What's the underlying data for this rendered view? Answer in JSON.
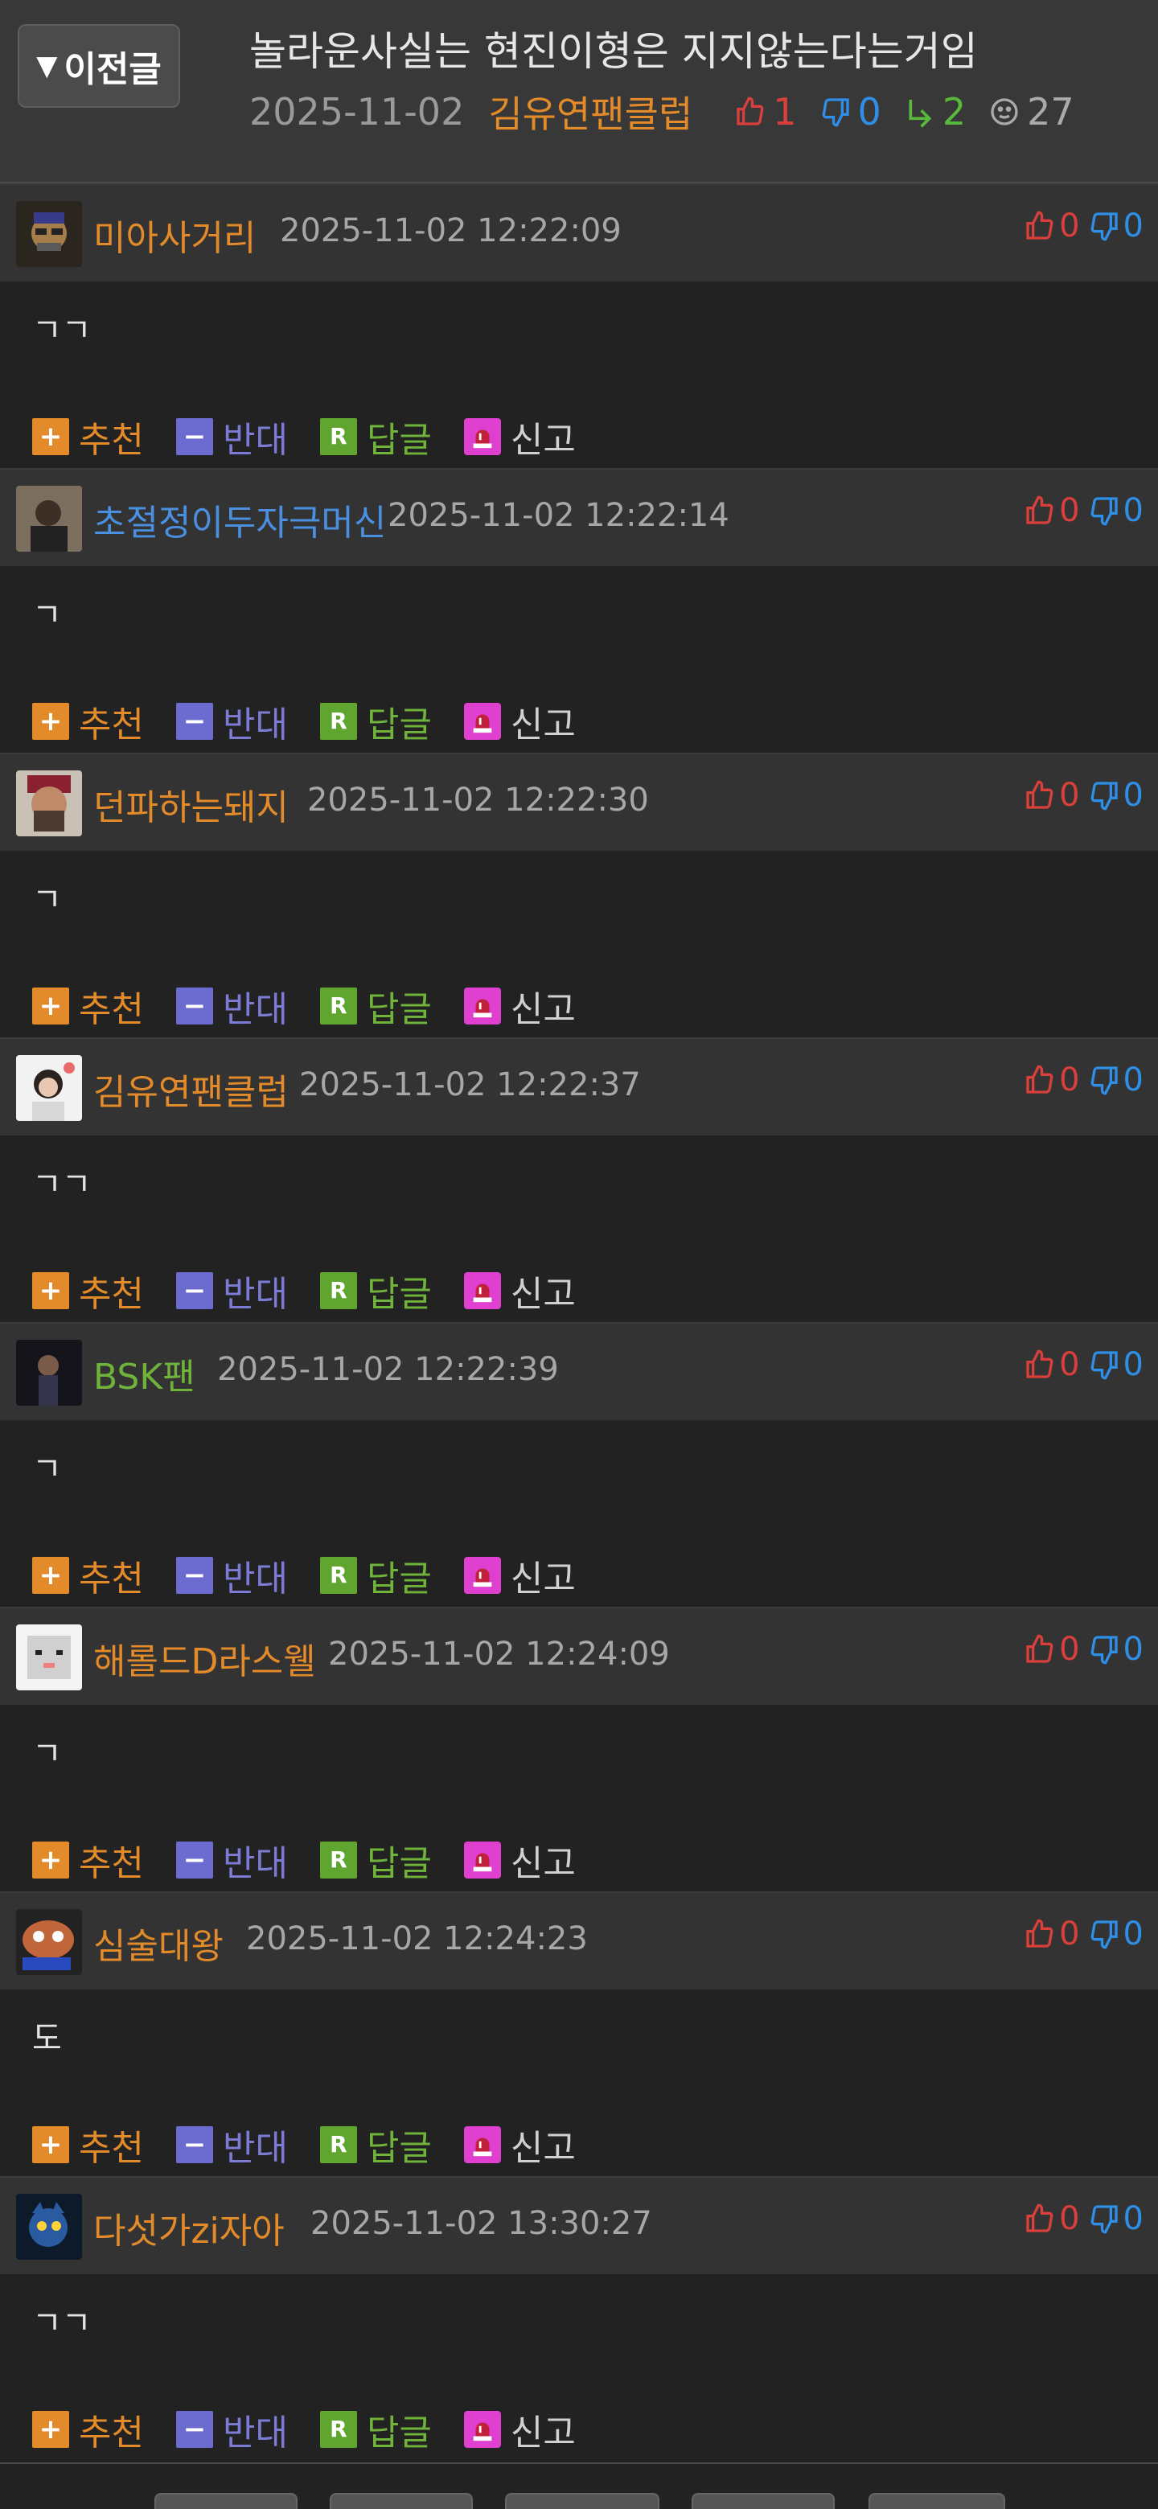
{
  "header": {
    "prev_label": "이전글",
    "title": "놀라운사실는 현진이형은 지지않는다는거임",
    "date": "2025-11-02",
    "author": "김유연팬클럽",
    "likes": "1",
    "dislikes": "0",
    "replies": "2",
    "views": "27"
  },
  "actions": {
    "recommend": "추천",
    "oppose": "반대",
    "reply": "답글",
    "report": "신고"
  },
  "colors": {
    "background": "#222222",
    "header": "#383838",
    "orange": "#e38a2a",
    "blue": "#4a8fe0",
    "green": "#6fb33b",
    "red": "#d9403c"
  },
  "comments": [
    {
      "nick": "미아사거리",
      "nick_color": "orange",
      "time": "2025-11-02 12:22:09",
      "up": "0",
      "down": "0",
      "text": "ㄱㄱ",
      "avatar": "avatar-1"
    },
    {
      "nick": "초절정이두자극머신",
      "nick_color": "blue",
      "time": "2025-11-02 12:22:14",
      "up": "0",
      "down": "0",
      "text": "ㄱ",
      "avatar": "avatar-2"
    },
    {
      "nick": "던파하는돼지",
      "nick_color": "orange",
      "time": "2025-11-02 12:22:30",
      "up": "0",
      "down": "0",
      "text": "ㄱ",
      "avatar": "avatar-3"
    },
    {
      "nick": "김유연팬클럽",
      "nick_color": "orange",
      "time": "2025-11-02 12:22:37",
      "up": "0",
      "down": "0",
      "text": "ㄱㄱ",
      "avatar": "avatar-4"
    },
    {
      "nick": "BSK팬",
      "nick_color": "green",
      "time": "2025-11-02 12:22:39",
      "up": "0",
      "down": "0",
      "text": "ㄱ",
      "avatar": "avatar-5"
    },
    {
      "nick": "해롤드D라스웰",
      "nick_color": "orange",
      "time": "2025-11-02 12:24:09",
      "up": "0",
      "down": "0",
      "text": "ㄱ",
      "avatar": "avatar-6"
    },
    {
      "nick": "심술대왕",
      "nick_color": "orange",
      "time": "2025-11-02 12:24:23",
      "up": "0",
      "down": "0",
      "text": "도",
      "avatar": "avatar-7"
    },
    {
      "nick": "다섯가zi자아",
      "nick_color": "orange",
      "time": "2025-11-02 13:30:27",
      "up": "0",
      "down": "0",
      "text": "ㄱㄱ",
      "avatar": "avatar-8"
    }
  ]
}
